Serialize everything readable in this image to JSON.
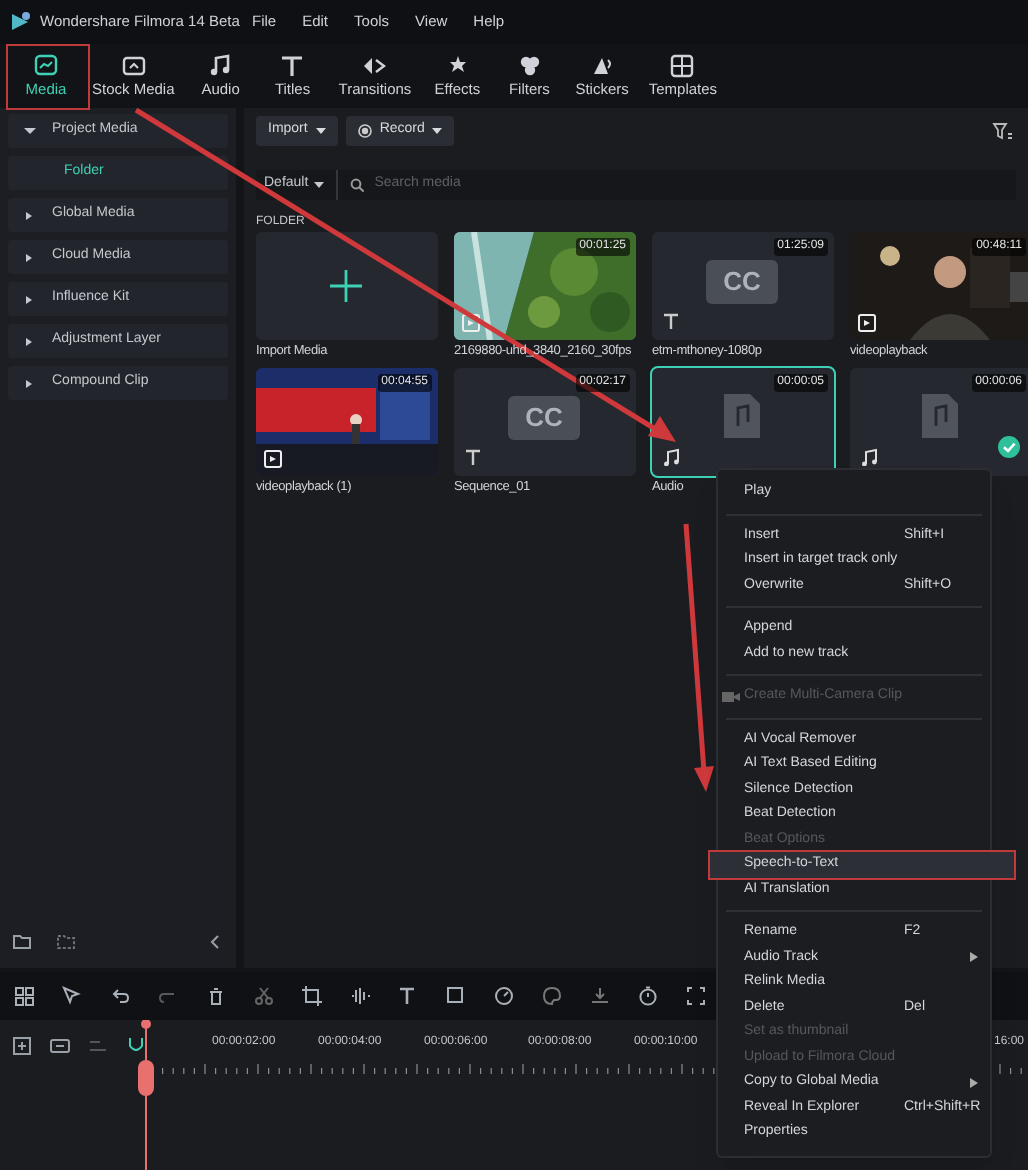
{
  "window": {
    "title": "Wondershare Filmora 14 Beta"
  },
  "menu_bar": [
    "File",
    "Edit",
    "Tools",
    "View",
    "Help"
  ],
  "tabs": [
    {
      "label": "Media",
      "selected": true
    },
    {
      "label": "Stock Media",
      "selected": false
    },
    {
      "label": "Audio",
      "selected": false
    },
    {
      "label": "Titles",
      "selected": false
    },
    {
      "label": "Transitions",
      "selected": false
    },
    {
      "label": "Effects",
      "selected": false
    },
    {
      "label": "Filters",
      "selected": false
    },
    {
      "label": "Stickers",
      "selected": false
    },
    {
      "label": "Templates",
      "selected": false
    }
  ],
  "sidebar": {
    "items": [
      {
        "label": "Project Media",
        "expanded": true,
        "children": [
          {
            "label": "Folder",
            "selected": true
          }
        ]
      },
      {
        "label": "Global Media",
        "expanded": false
      },
      {
        "label": "Cloud Media",
        "expanded": false
      },
      {
        "label": "Influence Kit",
        "expanded": false
      },
      {
        "label": "Adjustment Layer",
        "expanded": false
      },
      {
        "label": "Compound Clip",
        "expanded": false
      }
    ]
  },
  "toolbar": {
    "import": "Import",
    "record": "Record",
    "sort": "Default",
    "search": {
      "placeholder": "Search media"
    }
  },
  "folder_heading": "FOLDER",
  "media": [
    {
      "kind": "import",
      "label": "Import Media",
      "selected": false,
      "used": false
    },
    {
      "kind": "aerial",
      "label": "2169880-uhd_3840_2160_30fps",
      "duration": "00:01:25",
      "selected": false,
      "used": false
    },
    {
      "kind": "caption",
      "badge": "CC",
      "label": "etm-mthoney-1080p",
      "duration": "01:25:09",
      "selected": false,
      "used": false
    },
    {
      "kind": "person",
      "label": "videoplayback",
      "duration": "00:48:11",
      "selected": false,
      "used": false
    },
    {
      "kind": "stage",
      "label": "videoplayback (1)",
      "duration": "00:04:55",
      "selected": false,
      "used": false
    },
    {
      "kind": "caption",
      "badge": "CC",
      "label": "Sequence_01",
      "duration": "00:02:17",
      "selected": false,
      "used": false
    },
    {
      "kind": "audio",
      "label": "Audio",
      "duration": "00:00:05",
      "selected": true,
      "used": false
    },
    {
      "kind": "audio",
      "duration": "00:00:06",
      "selected": false,
      "used": true
    }
  ],
  "context_menu": {
    "groups": [
      [
        {
          "label": "Play",
          "kind": "plain",
          "disabled": false,
          "selected": false,
          "submenu": false
        }
      ],
      [
        {
          "label": "Insert",
          "shortcut": "Shift+I",
          "kind": "plain",
          "disabled": false,
          "selected": false,
          "submenu": false
        },
        {
          "label": "Insert in target track only",
          "kind": "plain",
          "disabled": false,
          "selected": false,
          "submenu": false
        },
        {
          "label": "Overwrite",
          "shortcut": "Shift+O",
          "kind": "plain",
          "disabled": false,
          "selected": false,
          "submenu": false
        }
      ],
      [
        {
          "label": "Append",
          "kind": "plain",
          "disabled": false,
          "selected": false,
          "submenu": false
        },
        {
          "label": "Add to new track",
          "kind": "plain",
          "disabled": false,
          "selected": false,
          "submenu": false
        }
      ],
      [
        {
          "label": "Create Multi-Camera Clip",
          "kind": "camera",
          "disabled": true,
          "selected": false,
          "submenu": false
        }
      ],
      [
        {
          "label": "AI Vocal Remover",
          "kind": "plain",
          "disabled": false,
          "selected": false,
          "submenu": false
        },
        {
          "label": "AI Text Based Editing",
          "kind": "plain",
          "disabled": false,
          "selected": false,
          "submenu": false
        },
        {
          "label": "Silence Detection",
          "kind": "plain",
          "disabled": false,
          "selected": false,
          "submenu": false
        },
        {
          "label": "Beat Detection",
          "kind": "plain",
          "disabled": false,
          "selected": false,
          "submenu": false
        },
        {
          "label": "Beat Options",
          "kind": "plain",
          "disabled": true,
          "selected": false,
          "submenu": false
        },
        {
          "label": "Speech-to-Text",
          "kind": "plain",
          "disabled": false,
          "selected": true,
          "submenu": false
        },
        {
          "label": "AI Translation",
          "kind": "plain",
          "disabled": false,
          "selected": false,
          "submenu": false
        }
      ],
      [
        {
          "label": "Rename",
          "shortcut": "F2",
          "kind": "plain",
          "disabled": false,
          "selected": false,
          "submenu": false
        },
        {
          "label": "Audio Track",
          "kind": "plain",
          "disabled": false,
          "selected": false,
          "submenu": true
        },
        {
          "label": "Relink Media",
          "kind": "plain",
          "disabled": false,
          "selected": false,
          "submenu": false
        },
        {
          "label": "Delete",
          "shortcut": "Del",
          "kind": "plain",
          "disabled": false,
          "selected": false,
          "submenu": false
        },
        {
          "label": "Set as thumbnail",
          "kind": "plain",
          "disabled": true,
          "selected": false,
          "submenu": false
        },
        {
          "label": "Upload to Filmora Cloud",
          "kind": "plain",
          "disabled": true,
          "selected": false,
          "submenu": false
        },
        {
          "label": "Copy to Global Media",
          "kind": "plain",
          "disabled": false,
          "selected": false,
          "submenu": true
        },
        {
          "label": "Reveal In Explorer",
          "shortcut": "Ctrl+Shift+R",
          "kind": "plain",
          "disabled": false,
          "selected": false,
          "submenu": false
        },
        {
          "label": "Properties",
          "kind": "plain",
          "disabled": false,
          "selected": false,
          "submenu": false
        }
      ]
    ]
  },
  "timeline": {
    "ruler": [
      "00:00:02:00",
      "00:00:04:00",
      "00:00:06:00",
      "00:00:08:00",
      "00:00:10:00",
      "16:00"
    ]
  }
}
